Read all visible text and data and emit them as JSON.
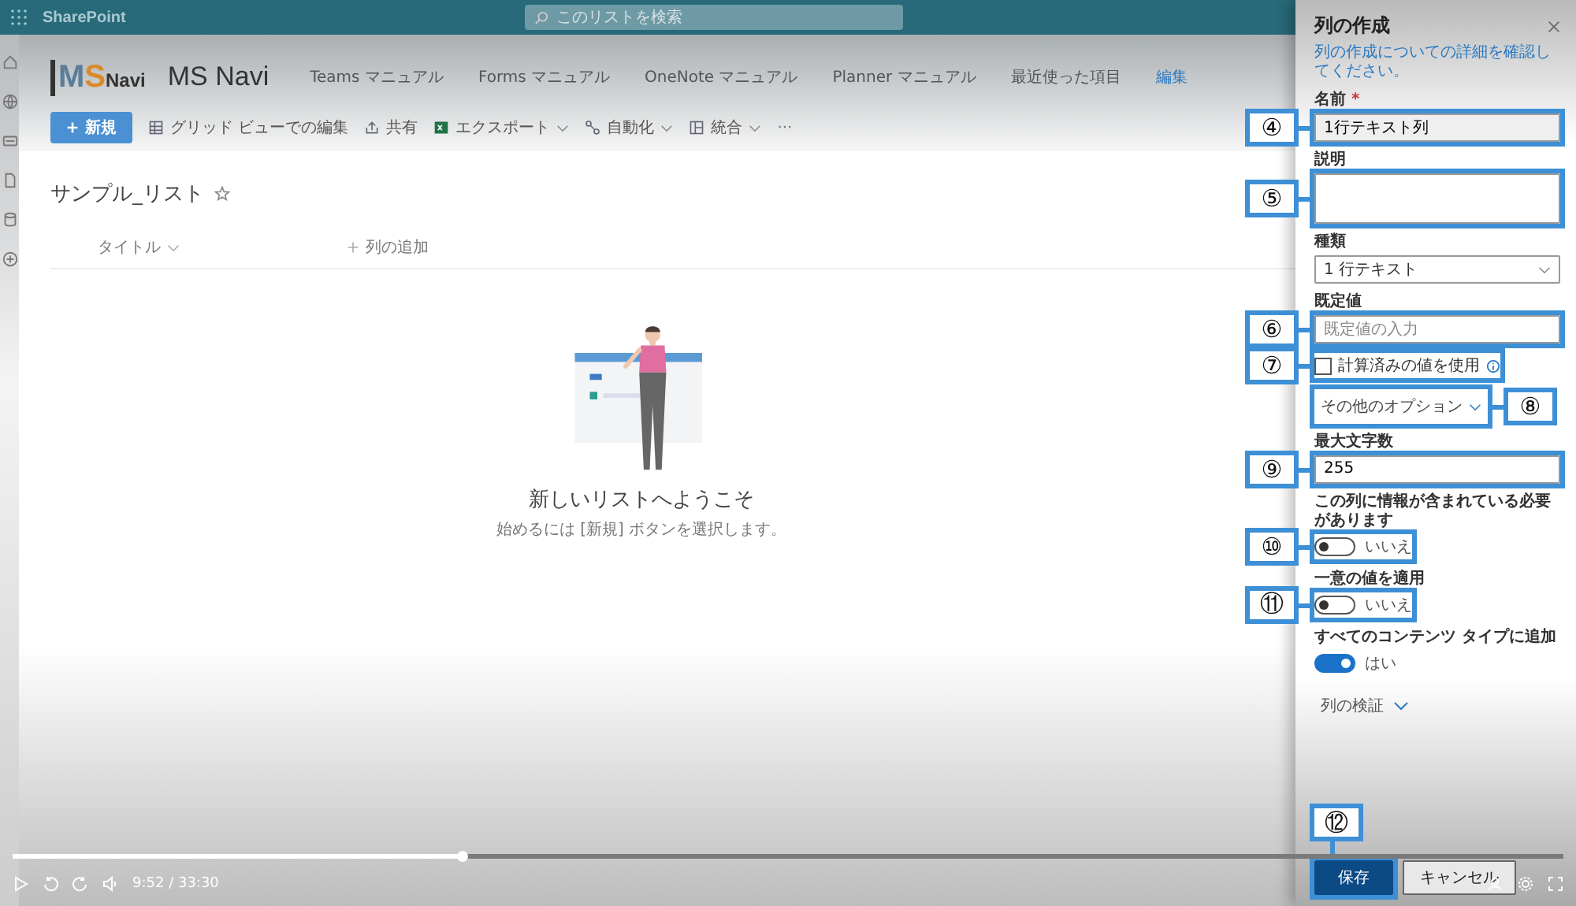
{
  "top_bar": {
    "app_name": "SharePoint",
    "search": {
      "placeholder": "このリストを検索"
    }
  },
  "site": {
    "logo": [
      "M",
      "S",
      "Navi"
    ],
    "title": "MS Navi",
    "nav": [
      "Teams マニュアル",
      "Forms マニュアル",
      "OneNote マニュアル",
      "Planner マニュアル",
      "最近使った項目"
    ],
    "edit_link": "編集"
  },
  "command_bar": {
    "new_button": "新規",
    "items": [
      {
        "label": "グリッド ビューでの編集",
        "kind": "grid",
        "dropdown": false
      },
      {
        "label": "共有",
        "kind": "share",
        "dropdown": false
      },
      {
        "label": "エクスポート",
        "kind": "excel",
        "dropdown": true
      },
      {
        "label": "自動化",
        "kind": "flow",
        "dropdown": true
      },
      {
        "label": "統合",
        "kind": "integrate",
        "dropdown": true
      }
    ],
    "more": "···"
  },
  "list": {
    "title": "サンプル_リスト",
    "columns": [
      {
        "label": "タイトル",
        "kind": "column"
      },
      {
        "label": "列の追加",
        "kind": "add"
      }
    ],
    "empty_state": {
      "title": "新しいリストへようこそ",
      "subtitle": "始めるには [新規] ボタンを選択します。"
    }
  },
  "panel": {
    "title": "列の作成",
    "help_link": "列の作成についての詳細を確認してください。",
    "fields": [
      {
        "kind": "text",
        "label": "名前",
        "required_mark": "*",
        "value": "1行テキスト列",
        "callout": "④"
      },
      {
        "kind": "textarea",
        "label": "説明",
        "callout": "⑤"
      },
      {
        "kind": "dropdown",
        "label": "種類",
        "value": "1 行テキスト"
      },
      {
        "kind": "text",
        "label": "既定値",
        "placeholder": "既定値の入力",
        "callout": "⑥"
      },
      {
        "kind": "checkbox",
        "label": "計算済みの値を使用",
        "checked": false,
        "callout": "⑦"
      },
      {
        "kind": "link",
        "label": "その他のオプション",
        "callout": "⑧"
      },
      {
        "kind": "text",
        "label": "最大文字数",
        "value": "255",
        "callout": "⑨"
      },
      {
        "kind": "toggle",
        "label": "この列に情報が含まれている必要があります",
        "on": false,
        "state_label": "いいえ",
        "callout": "⑩"
      },
      {
        "kind": "toggle",
        "label": "一意の値を適用",
        "on": false,
        "state_label": "いいえ",
        "callout": "⑪"
      },
      {
        "kind": "toggle",
        "label": "すべてのコンテンツ タイプに追加",
        "on": true,
        "state_label": "はい"
      },
      {
        "kind": "expander",
        "label": "列の検証"
      }
    ],
    "buttons": [
      {
        "label": "保存",
        "kind": "primary",
        "callout": "⑫"
      },
      {
        "label": "キャンセル",
        "kind": "default"
      }
    ]
  },
  "video": {
    "time": "9:52 / 33:30",
    "level": 0.29
  }
}
